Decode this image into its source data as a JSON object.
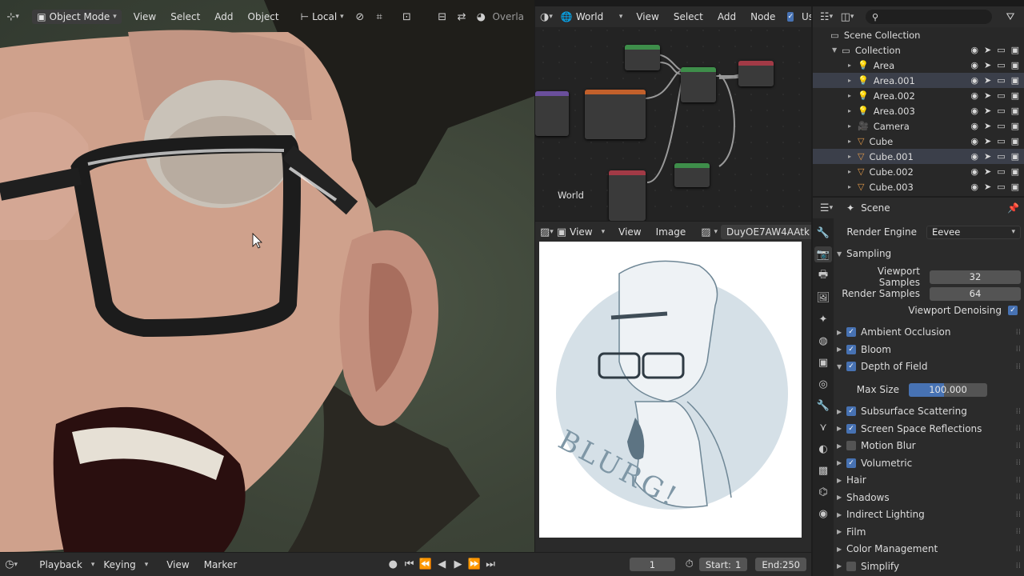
{
  "viewport": {
    "mode": "Object Mode",
    "menus": [
      "View",
      "Select",
      "Add",
      "Object"
    ],
    "transform_orientation": "Local",
    "overlays_label": "Overla"
  },
  "node_editor": {
    "shader_type": "World",
    "menus": [
      "View",
      "Select",
      "Add",
      "Node"
    ],
    "use_nodes_label": "Use N",
    "world_label": "World"
  },
  "image_editor": {
    "menus": [
      "View",
      "View",
      "Image"
    ],
    "image_name": "DuyOE7AW4AAtk",
    "drawing_text": "BLURG!"
  },
  "outliner": {
    "root": "Scene Collection",
    "collection": "Collection",
    "items": [
      {
        "name": "Area",
        "icon": "light-icon",
        "selected": false
      },
      {
        "name": "Area.001",
        "icon": "light-icon",
        "selected": true
      },
      {
        "name": "Area.002",
        "icon": "light-icon",
        "selected": false
      },
      {
        "name": "Area.003",
        "icon": "light-icon",
        "selected": false
      },
      {
        "name": "Camera",
        "icon": "camera-icon",
        "selected": false
      },
      {
        "name": "Cube",
        "icon": "mesh-icon",
        "selected": false
      },
      {
        "name": "Cube.001",
        "icon": "mesh-icon",
        "selected": true
      },
      {
        "name": "Cube.002",
        "icon": "mesh-icon",
        "selected": false
      },
      {
        "name": "Cube.003",
        "icon": "mesh-icon",
        "selected": false
      }
    ]
  },
  "properties": {
    "context": "Scene",
    "render_engine_label": "Render Engine",
    "render_engine": "Eevee",
    "sampling": {
      "title": "Sampling",
      "viewport_samples_label": "Viewport Samples",
      "viewport_samples": "32",
      "render_samples_label": "Render Samples",
      "render_samples": "64",
      "viewport_denoising_label": "Viewport Denoising"
    },
    "panels": [
      {
        "label": "Ambient Occlusion",
        "checkbox": true,
        "checked": true
      },
      {
        "label": "Bloom",
        "checkbox": true,
        "checked": true
      },
      {
        "label": "Depth of Field",
        "checkbox": true,
        "checked": true
      }
    ],
    "dof": {
      "max_size_label": "Max Size",
      "max_size": "100.000",
      "max_size_fill": 0.45
    },
    "panels2": [
      {
        "label": "Subsurface Scattering",
        "checkbox": true,
        "checked": true
      },
      {
        "label": "Screen Space Reflections",
        "checkbox": true,
        "checked": true
      },
      {
        "label": "Motion Blur",
        "checkbox": true,
        "checked": false
      },
      {
        "label": "Volumetric",
        "checkbox": true,
        "checked": true
      },
      {
        "label": "Hair",
        "checkbox": false,
        "checked": false
      },
      {
        "label": "Shadows",
        "checkbox": false,
        "checked": false
      },
      {
        "label": "Indirect Lighting",
        "checkbox": false,
        "checked": false
      },
      {
        "label": "Film",
        "checkbox": false,
        "checked": false
      },
      {
        "label": "Color Management",
        "checkbox": false,
        "checked": false
      },
      {
        "label": "Simplify",
        "checkbox": true,
        "checked": false
      }
    ]
  },
  "timeline": {
    "menus": [
      "Playback",
      "Keying",
      "View",
      "Marker"
    ],
    "current_frame": "1",
    "start_label": "Start:",
    "start": "1",
    "end_label": "End:",
    "end": "250"
  },
  "colors": {
    "accent": "#4772b3",
    "header": "#2b2b2b",
    "selected_row": "#3b3f4a"
  }
}
